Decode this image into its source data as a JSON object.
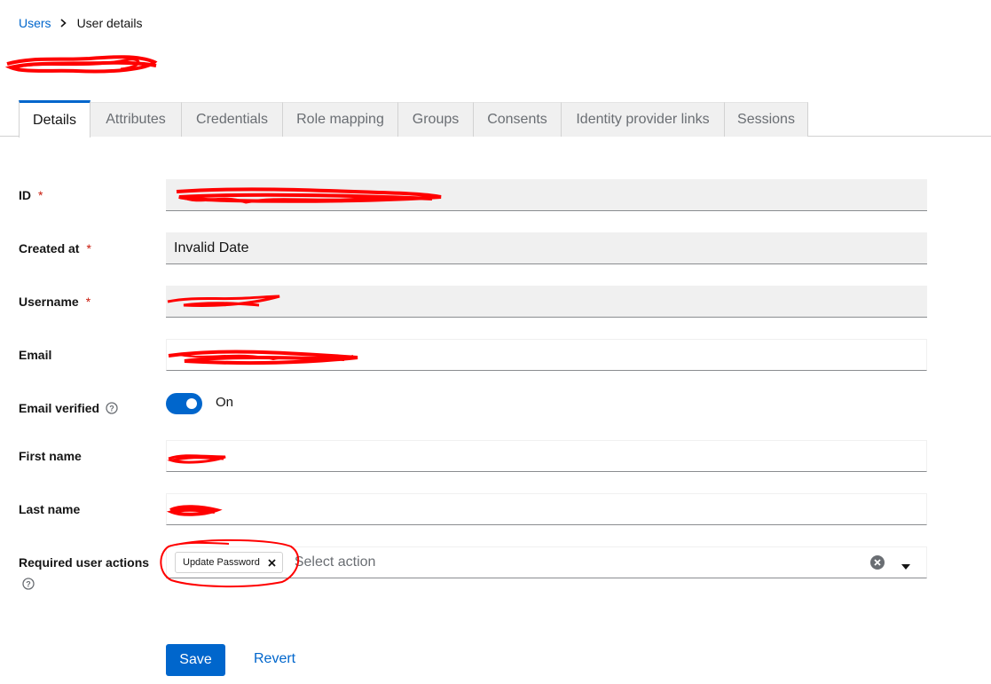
{
  "breadcrumb": {
    "parent": "Users",
    "current": "User details"
  },
  "tabs": [
    "Details",
    "Attributes",
    "Credentials",
    "Role mapping",
    "Groups",
    "Consents",
    "Identity provider links",
    "Sessions"
  ],
  "form": {
    "id": {
      "label": "ID",
      "required": "*"
    },
    "created_at": {
      "label": "Created at",
      "required": "*",
      "value": "Invalid Date"
    },
    "username": {
      "label": "Username",
      "required": "*"
    },
    "email": {
      "label": "Email"
    },
    "email_verified": {
      "label": "Email verified",
      "state": "On",
      "on": true
    },
    "first_name": {
      "label": "First name"
    },
    "last_name": {
      "label": "Last name"
    },
    "required_actions": {
      "label": "Required user actions",
      "chip": "Update Password",
      "placeholder": "Select action"
    }
  },
  "actions": {
    "save": "Save",
    "revert": "Revert"
  },
  "colors": {
    "accent": "#0066cc",
    "required": "#c9190b",
    "annotation": "#ff0000"
  }
}
